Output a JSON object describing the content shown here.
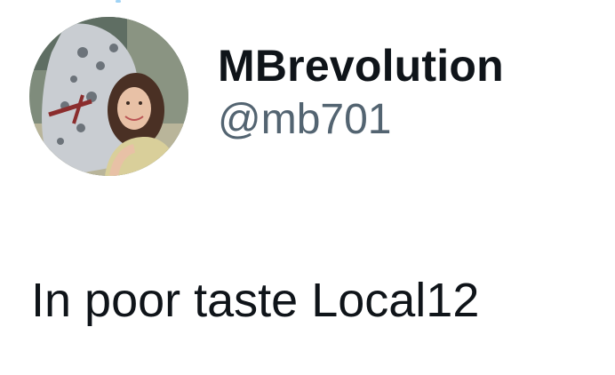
{
  "tweet": {
    "author": {
      "display_name": "MBrevolution",
      "handle": "@mb701",
      "avatar_icon": "profile-photo-avatar"
    },
    "text": "In poor taste Local12"
  },
  "colors": {
    "text_primary": "#0f1419",
    "text_secondary": "#536471",
    "background": "#ffffff"
  }
}
